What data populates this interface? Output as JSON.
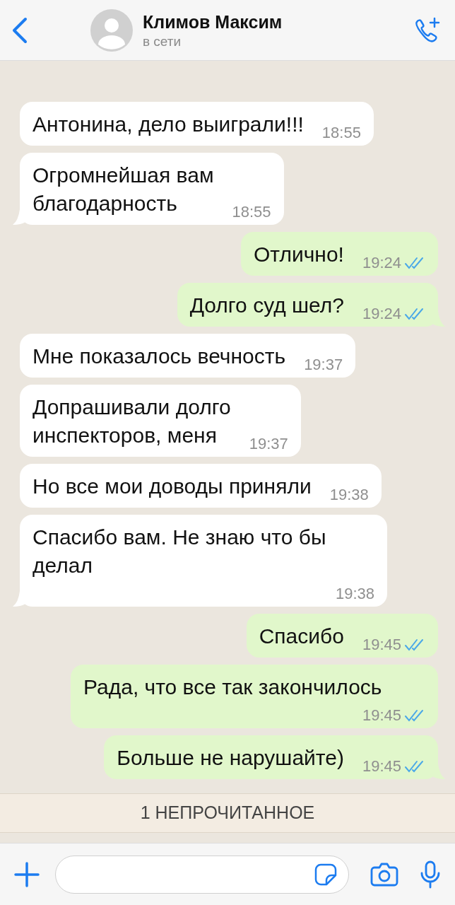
{
  "header": {
    "name": "Климов Максим",
    "status": "в сети"
  },
  "messages": [
    {
      "kind": "incoming",
      "text": "Антонина, дело выиграли!!!",
      "time": "18:55",
      "tail": false
    },
    {
      "kind": "incoming",
      "text": "Огромнейшая вам\nблагодарность",
      "time": "18:55",
      "tail": true
    },
    {
      "kind": "outgoing",
      "text": "Отлично!",
      "time": "19:24",
      "read": true,
      "tail": false
    },
    {
      "kind": "outgoing",
      "text": "Долго суд шел?",
      "time": "19:24",
      "read": true,
      "tail": true
    },
    {
      "kind": "incoming",
      "text": "Мне показалось вечность",
      "time": "19:37",
      "tail": false
    },
    {
      "kind": "incoming",
      "text": "Допрашивали долго\nинспекторов, меня",
      "time": "19:37",
      "tail": false
    },
    {
      "kind": "incoming",
      "text": "Но все мои доводы приняли",
      "time": "19:38",
      "tail": false
    },
    {
      "kind": "incoming",
      "text": "Спасибо вам. Не знаю что бы\nделал",
      "time": "19:38",
      "tail": true
    },
    {
      "kind": "outgoing",
      "text": "Спасибо",
      "time": "19:45",
      "read": true,
      "tail": false
    },
    {
      "kind": "outgoing",
      "text": "Рада, что все так закончилось",
      "time": "19:45",
      "read": true,
      "tail": false
    },
    {
      "kind": "outgoing",
      "text": "Больше не нарушайте)",
      "time": "19:45",
      "read": true,
      "tail": true
    }
  ],
  "unread_banner": "1 НЕПРОЧИТАННОЕ"
}
